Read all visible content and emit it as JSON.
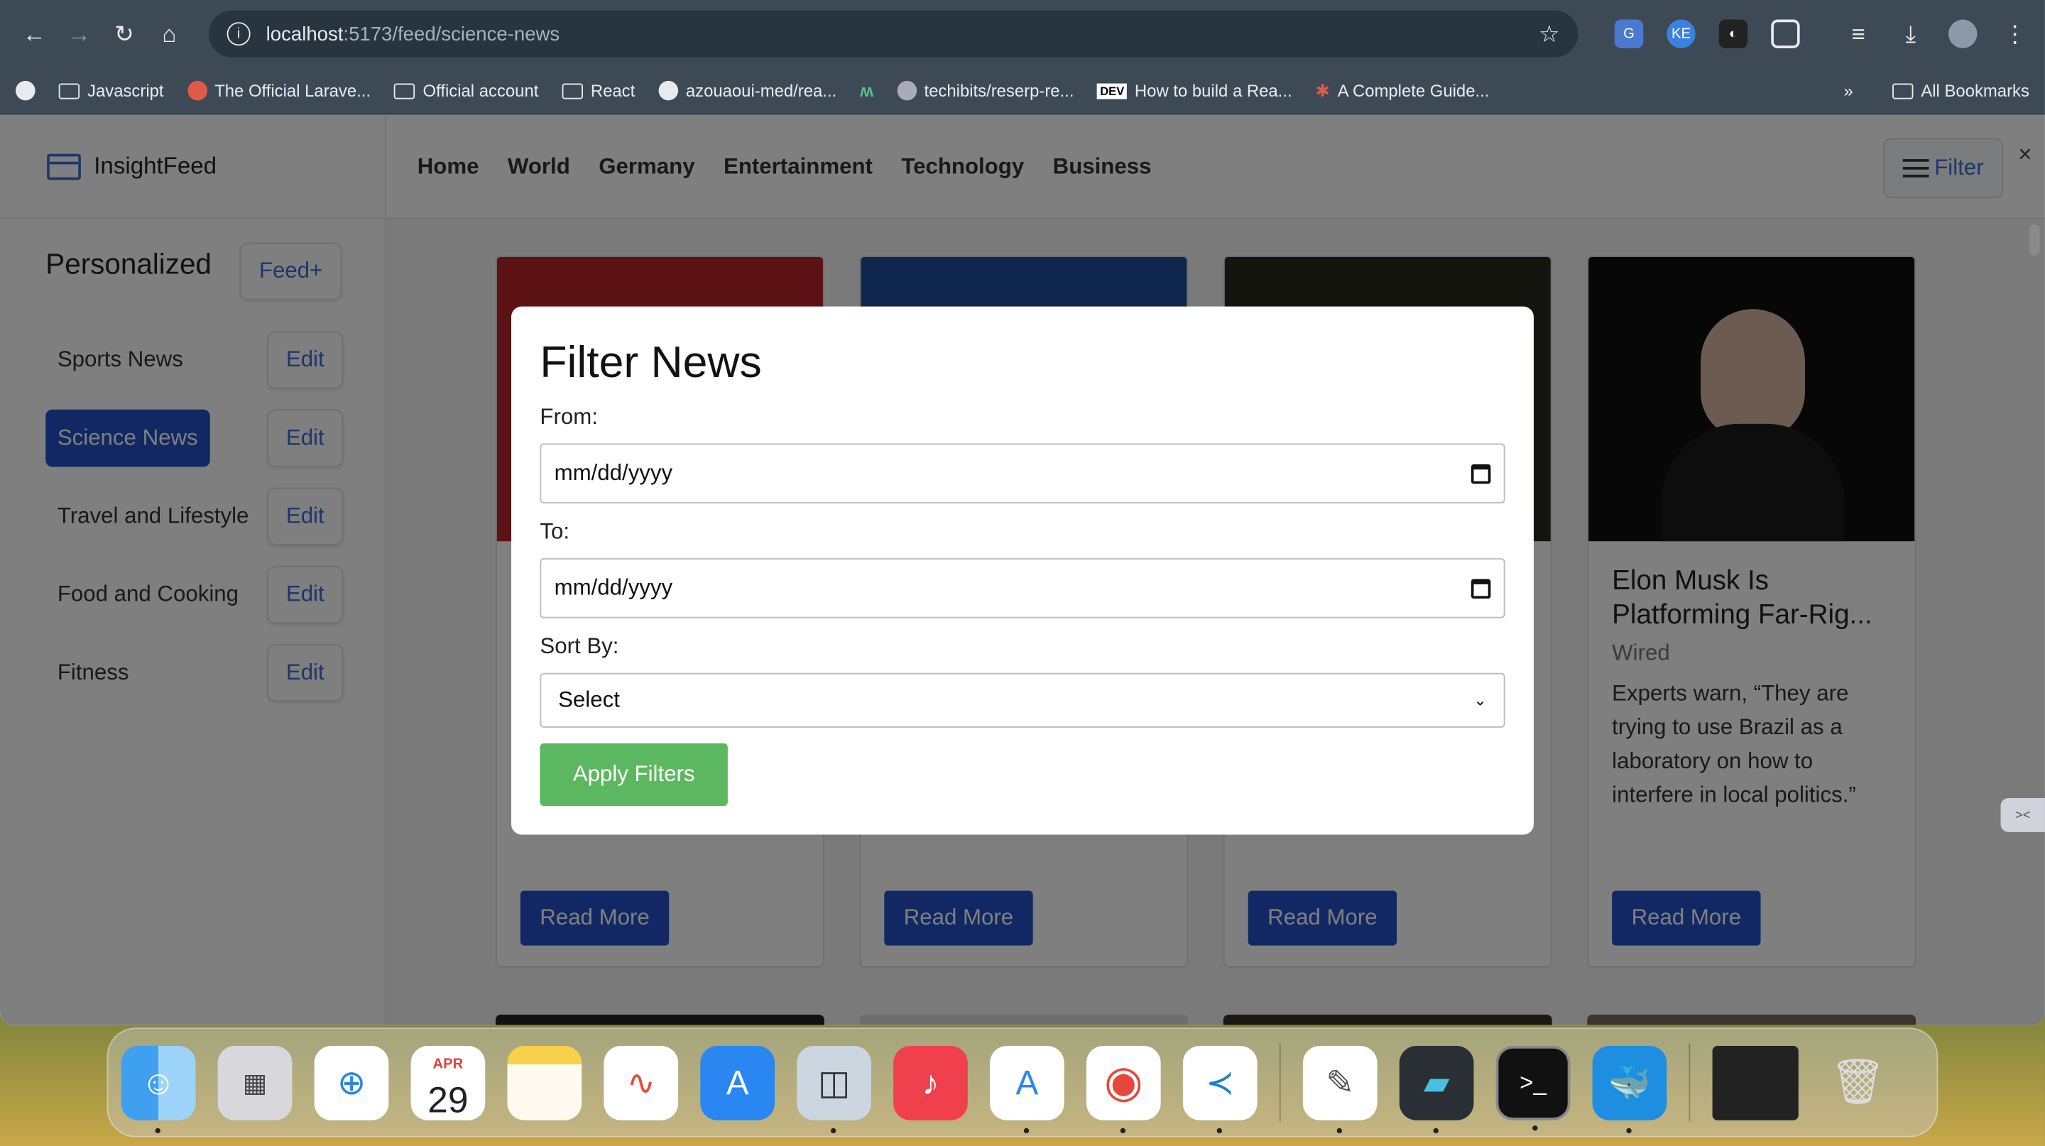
{
  "browser": {
    "url_host": "localhost",
    "url_path": ":5173/feed/science-news",
    "bookmarks": [
      {
        "label": "Javascript",
        "kind": "folder"
      },
      {
        "label": "The Official Larave...",
        "kind": "site"
      },
      {
        "label": "Official account",
        "kind": "folder"
      },
      {
        "label": "React",
        "kind": "folder"
      },
      {
        "label": "azouaoui-med/rea...",
        "kind": "site"
      },
      {
        "label": "techibits/reserp-re...",
        "kind": "site"
      },
      {
        "label": "How to build a Rea...",
        "kind": "site"
      },
      {
        "label": "A Complete Guide...",
        "kind": "site"
      }
    ],
    "all_bookmarks": "All Bookmarks",
    "more_chevron": "»"
  },
  "app": {
    "brand": "InsightFeed",
    "menu": [
      "Home",
      "World",
      "Germany",
      "Entertainment",
      "Technology",
      "Business"
    ],
    "filter_label": "Filter",
    "close": "×"
  },
  "sidebar": {
    "title": "Personalized",
    "feed_plus": "Feed+",
    "edit_label": "Edit",
    "feeds": [
      "Sports News",
      "Science News",
      "Travel and Lifestyle",
      "Food and Cooking",
      "Fitness"
    ],
    "active_feed": "Science News"
  },
  "cards": [
    {
      "image_color": "#b8242a"
    },
    {
      "image_color": "#1f4f9e"
    },
    {
      "image_color": "#2b2a1f"
    },
    {
      "image_color": "#0e0e0e",
      "title": "Elon Musk Is Platforming Far-Rig...",
      "source": "Wired",
      "description": "Experts warn, “They are trying to use Brazil as a laboratory on how to interfere in local politics.”"
    }
  ],
  "read_more": "Read More",
  "modal": {
    "title": "Filter News",
    "from_label": "From:",
    "to_label": "To:",
    "date_placeholder": "mm/dd/yyyy",
    "sort_label": "Sort By:",
    "sort_value": "Select",
    "apply": "Apply Filters"
  },
  "dock": {
    "calendar_month": "APR",
    "calendar_day": "29",
    "apps": [
      "finder",
      "launchpad",
      "safari",
      "calendar",
      "notes",
      "freeform",
      "app-store",
      "preview",
      "music",
      "xcode-instruments",
      "chrome",
      "vscode",
      "textedit",
      "sidecar",
      "terminal",
      "docker",
      "window",
      "trash"
    ]
  }
}
